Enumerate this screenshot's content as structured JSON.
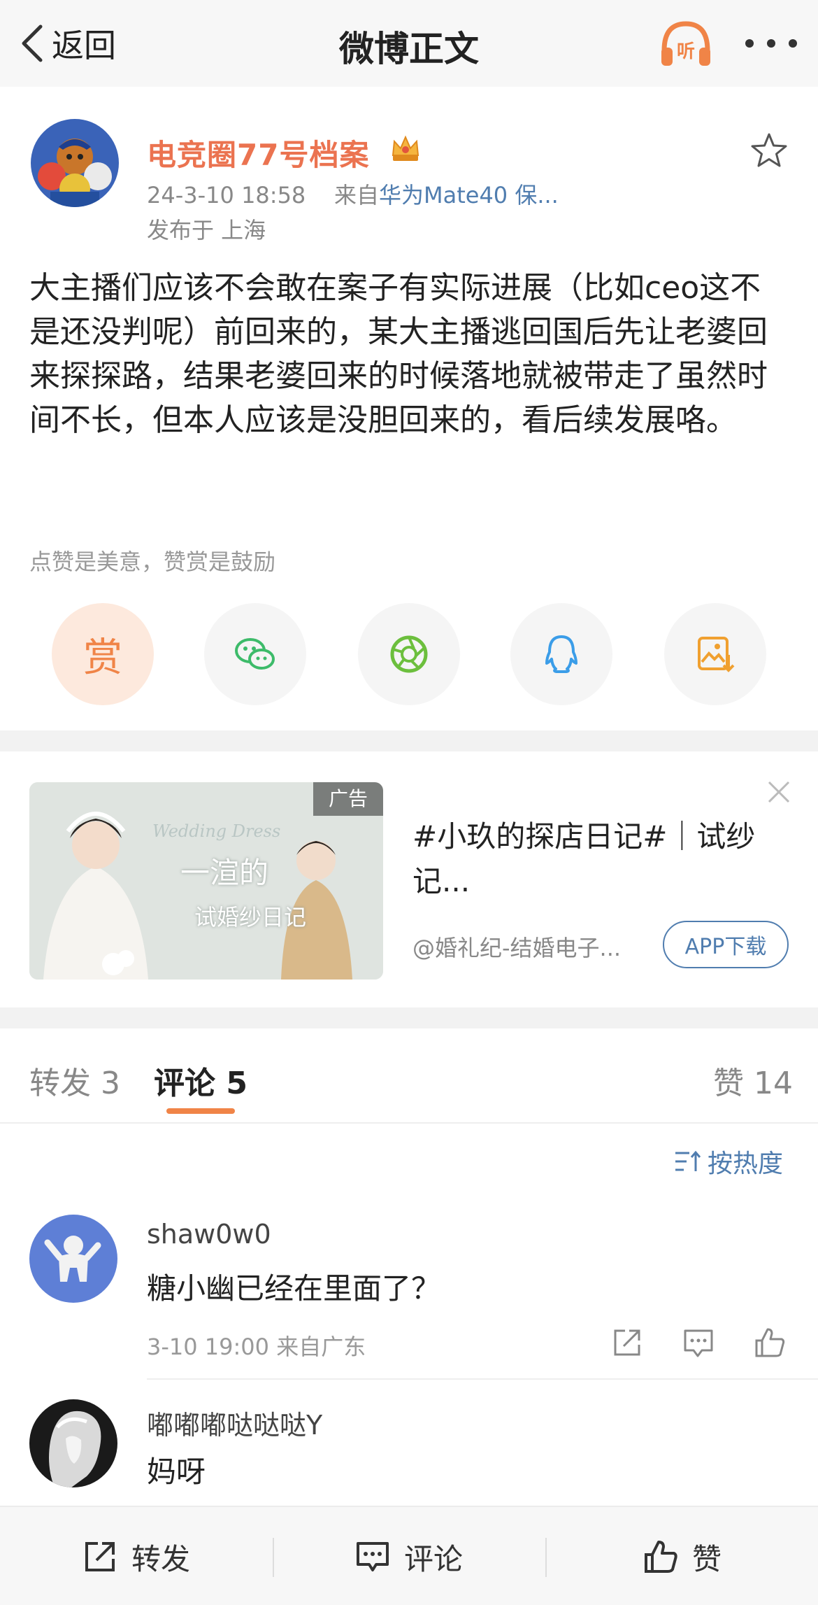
{
  "nav": {
    "back_label": "返回",
    "title": "微博正文",
    "listen_label": "听"
  },
  "post": {
    "author": "电竞圈77号档案",
    "time": "24-3-10 18:58",
    "source_prefix": "来自",
    "device": "华为Mate40 保...",
    "location": "发布于 上海",
    "text": "大主播们应该不会敢在案子有实际进展（比如ceo这不是还没判呢）前回来的，某大主播逃回国后先让老婆回来探探路，结果老婆回来的时候落地就被带走了虽然时间不长，但本人应该是没胆回来的，看后续发展咯。",
    "reward_tip": "点赞是美意，赞赏是鼓励",
    "reward_label": "赏"
  },
  "ad": {
    "label": "广告",
    "title": "#小玖的探店日记#｜试纱记...",
    "source": "@婚礼纪-结婚电子...",
    "app_button": "APP下载",
    "image_caption_1": "一渲的",
    "image_caption_2": "试婚纱日记",
    "image_script": "Wedding Dress"
  },
  "tabs": {
    "repost_label": "转发 3",
    "comment_label": "评论 5",
    "like_label": "赞 14"
  },
  "sort_label": "按热度",
  "comments": [
    {
      "user": "shaw0w0",
      "text": "糖小幽已经在里面了？",
      "meta": "3-10 19:00 来自广东"
    },
    {
      "user": "嘟嘟嘟哒哒哒Y",
      "text": "妈呀"
    }
  ],
  "bottom_bar": {
    "repost": "转发",
    "comment": "评论",
    "like": "赞"
  },
  "colors": {
    "accent_orange": "#eb7350",
    "link_blue": "#507daf",
    "tab_underline": "#f08447"
  }
}
